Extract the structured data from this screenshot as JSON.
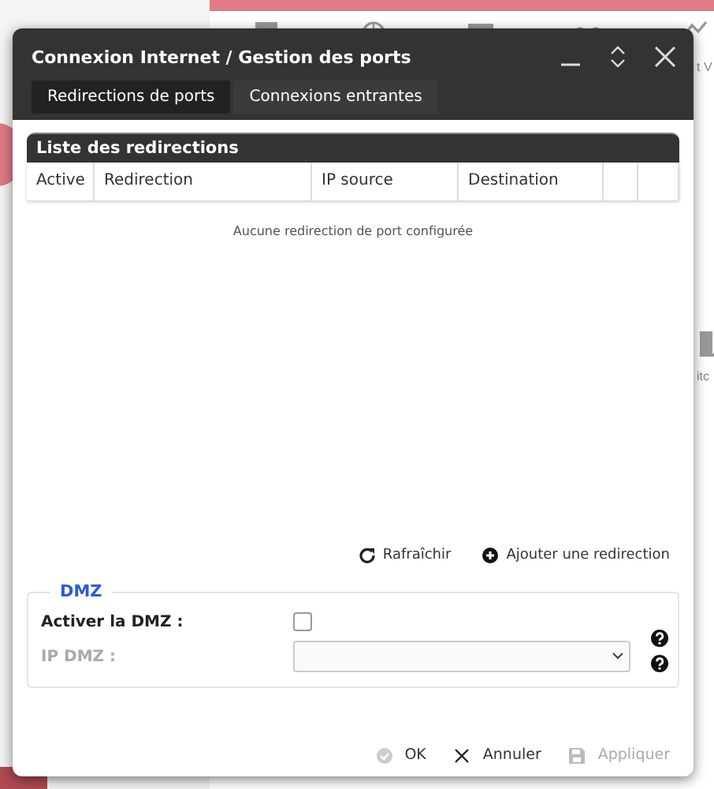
{
  "background": {
    "labels": [
      "t V",
      "itc"
    ]
  },
  "window": {
    "title": "Connexion Internet / Gestion des ports"
  },
  "tabs": [
    {
      "label": "Redirections de ports",
      "selected": true
    },
    {
      "label": "Connexions entrantes",
      "selected": false
    }
  ],
  "list": {
    "title": "Liste des redirections",
    "columns": [
      "Active",
      "Redirection",
      "IP source",
      "Destination"
    ],
    "empty_message": "Aucune redirection de port configurée"
  },
  "list_actions": [
    {
      "kind": "refresh",
      "label": "Rafraîchir"
    },
    {
      "kind": "add",
      "label": "Ajouter une redirection"
    }
  ],
  "dmz": {
    "legend": "DMZ",
    "enable": {
      "label": "Activer la DMZ :",
      "checked": false
    },
    "ip": {
      "label": "IP DMZ :",
      "disabled": true
    }
  },
  "footer": [
    {
      "kind": "ok",
      "label": "OK",
      "disabled": false
    },
    {
      "kind": "cancel",
      "label": "Annuler",
      "disabled": false
    },
    {
      "kind": "apply",
      "label": "Appliquer",
      "disabled": true
    }
  ]
}
